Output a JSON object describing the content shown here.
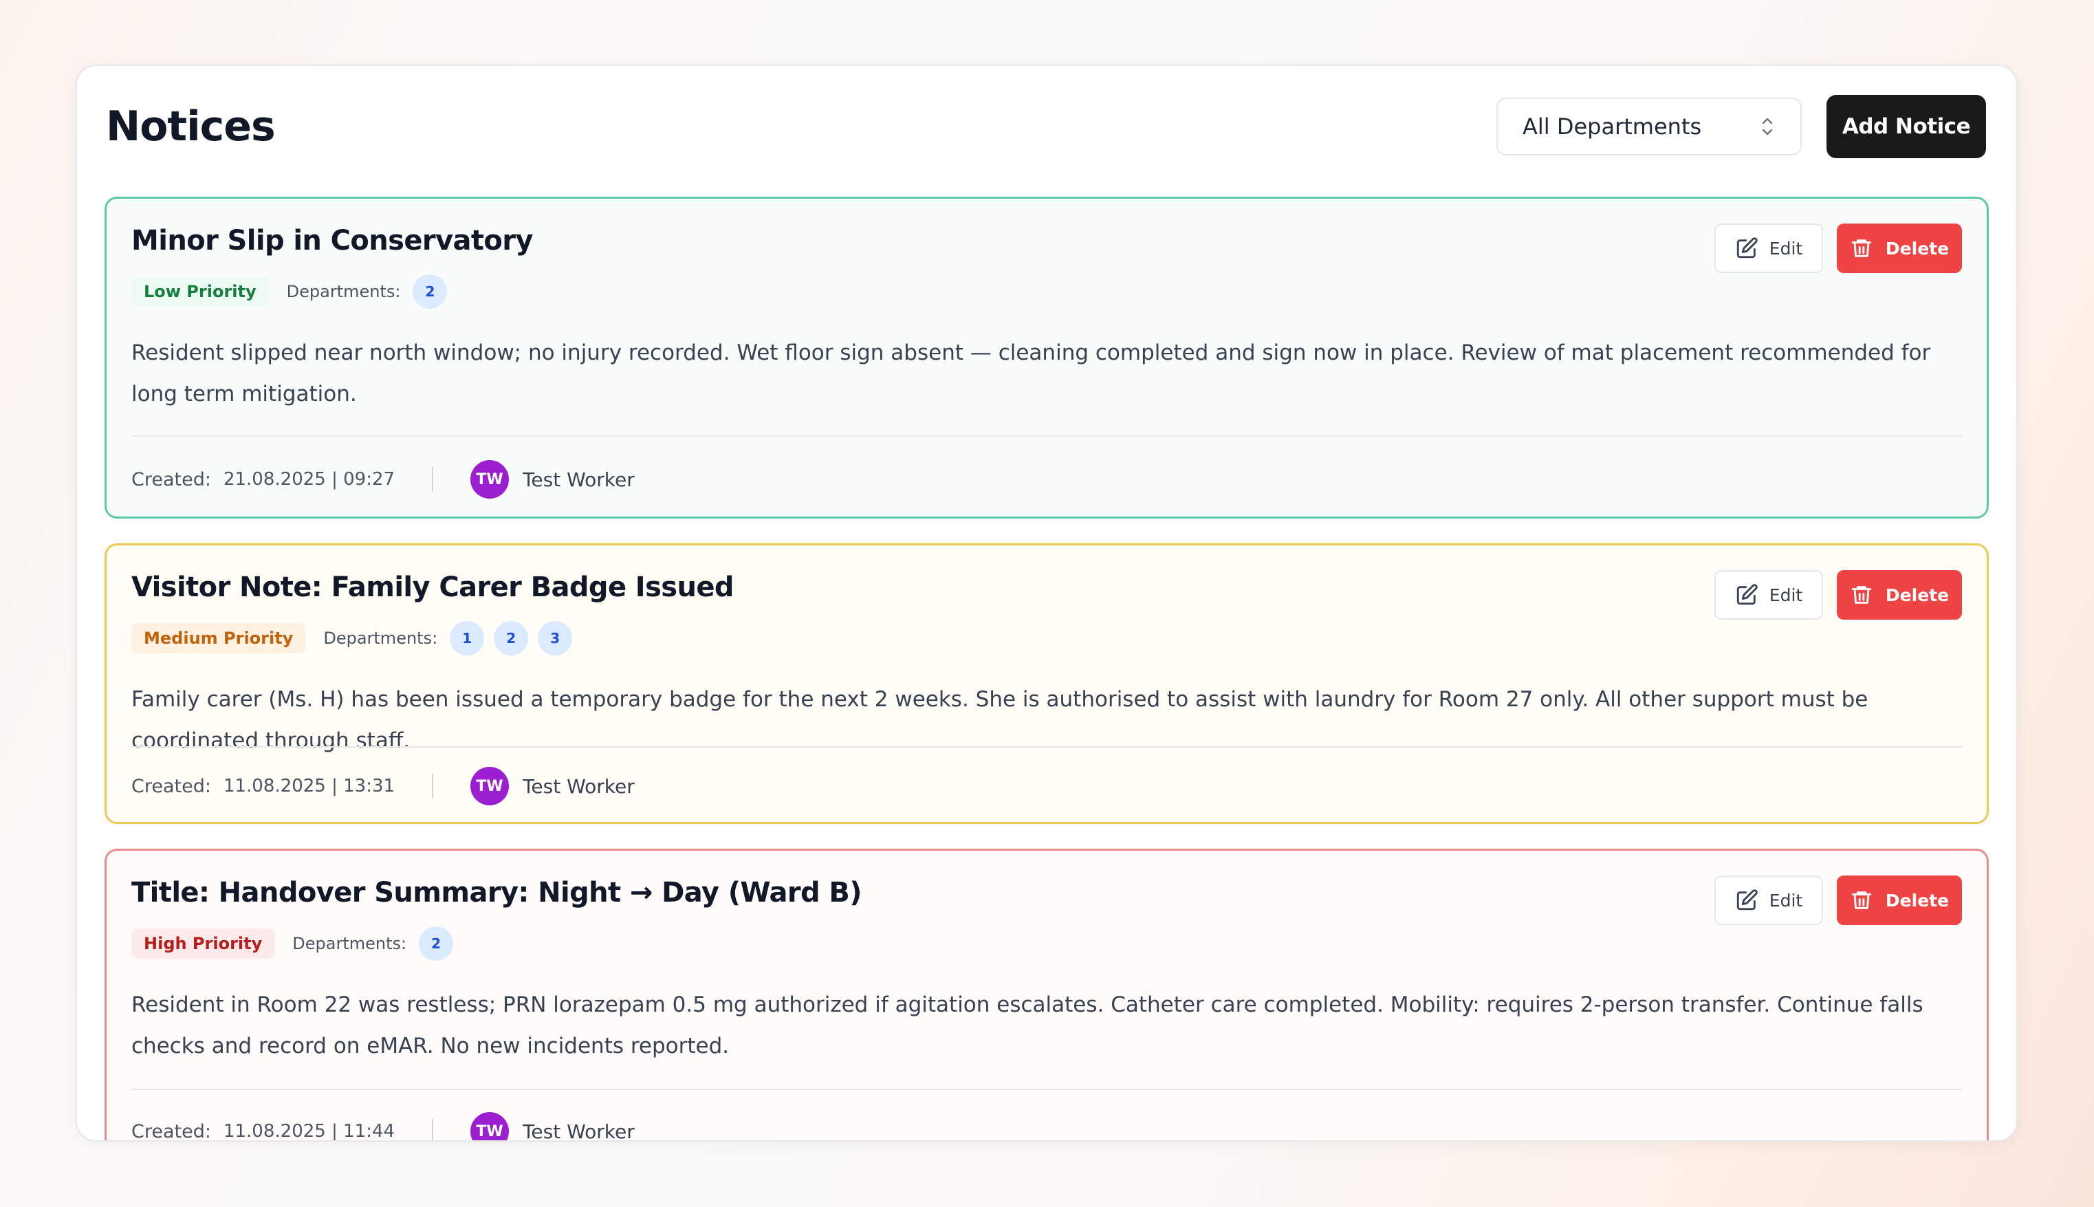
{
  "page": {
    "title": "Notices"
  },
  "filter": {
    "selected": "All Departments"
  },
  "toolbar": {
    "add_label": "Add Notice"
  },
  "actions": {
    "edit_label": "Edit",
    "delete_label": "Delete"
  },
  "labels": {
    "departments": "Departments:",
    "created": "Created:"
  },
  "colors": {
    "low_border": "#5ccaa5",
    "medium_border": "#ecc955",
    "high_border": "#ec8d8d",
    "delete_button": "#ef4444",
    "avatar": "#9b1fd0",
    "primary_button": "#1a1a1a"
  },
  "notices": [
    {
      "title": "Minor Slip in Conservatory",
      "priority": "Low Priority",
      "departments": [
        "2"
      ],
      "body": "Resident slipped near north window; no injury recorded. Wet floor sign absent — cleaning completed and sign now in place. Review of mat placement recommended for long term mitigation.",
      "created": "21.08.2025 | 09:27",
      "author_initials": "TW",
      "author": "Test Worker"
    },
    {
      "title": "Visitor Note: Family Carer Badge Issued",
      "priority": "Medium Priority",
      "departments": [
        "1",
        "2",
        "3"
      ],
      "body": "Family carer (Ms. H) has been issued a temporary badge for the next 2 weeks. She is authorised to assist with laundry for Room 27 only. All other support must be coordinated through staff.",
      "created": "11.08.2025 | 13:31",
      "author_initials": "TW",
      "author": "Test Worker"
    },
    {
      "title": "Title: Handover Summary: Night → Day (Ward B)",
      "priority": "High Priority",
      "departments": [
        "2"
      ],
      "body": "Resident in Room 22 was restless; PRN lorazepam 0.5 mg authorized if agitation escalates. Catheter care completed. Mobility: requires 2-person transfer. Continue falls checks and record on eMAR. No new incidents reported.",
      "created": "11.08.2025 | 11:44",
      "author_initials": "TW",
      "author": "Test Worker"
    }
  ]
}
